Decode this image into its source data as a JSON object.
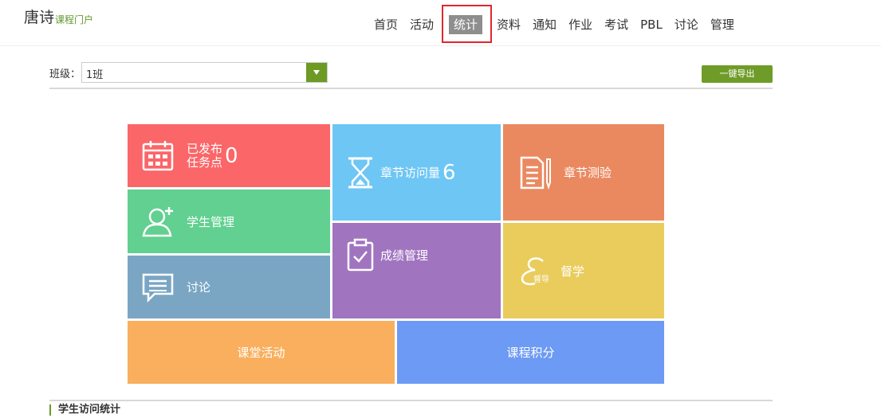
{
  "header": {
    "brand_main": "唐诗",
    "brand_sub": "课程门户"
  },
  "nav": {
    "items": [
      "首页",
      "活动",
      "统计",
      "资料",
      "通知",
      "作业",
      "考试",
      "PBL",
      "讨论",
      "管理"
    ],
    "active_index": 2
  },
  "toolbar": {
    "class_label": "班级：",
    "class_value": "1班",
    "export_label": "一键导出"
  },
  "tiles": {
    "published": {
      "label_line1": "已发布",
      "label_line2": "任务点",
      "value": "0",
      "icon": "calendar-icon"
    },
    "chapter_visits": {
      "label": "章节访问量",
      "value": "6",
      "icon": "hourglass-icon"
    },
    "chapter_quiz": {
      "label": "章节测验",
      "icon": "document-pen-icon"
    },
    "students": {
      "label": "学生管理",
      "icon": "user-add-icon"
    },
    "grades": {
      "label": "成绩管理",
      "icon": "clipboard-check-icon"
    },
    "supervise": {
      "label": "督学",
      "icon_text": "督导",
      "icon": "supervise-icon"
    },
    "discussion": {
      "label": "讨论",
      "icon": "chat-icon"
    },
    "classroom": {
      "label": "课堂活动"
    },
    "points": {
      "label": "课程积分"
    }
  },
  "colors": {
    "accent_green": "#6c9a23",
    "highlight_red": "#e0272d",
    "published": "#fb6668",
    "chapter_visits": "#6ec6f4",
    "chapter_quiz": "#ea8960",
    "students": "#61d090",
    "grades": "#a174c0",
    "supervise": "#e9cc5c",
    "discussion": "#7aa6c4",
    "classroom": "#f9af5d",
    "points": "#6c9af4"
  },
  "section": {
    "title": "学生访问统计"
  }
}
